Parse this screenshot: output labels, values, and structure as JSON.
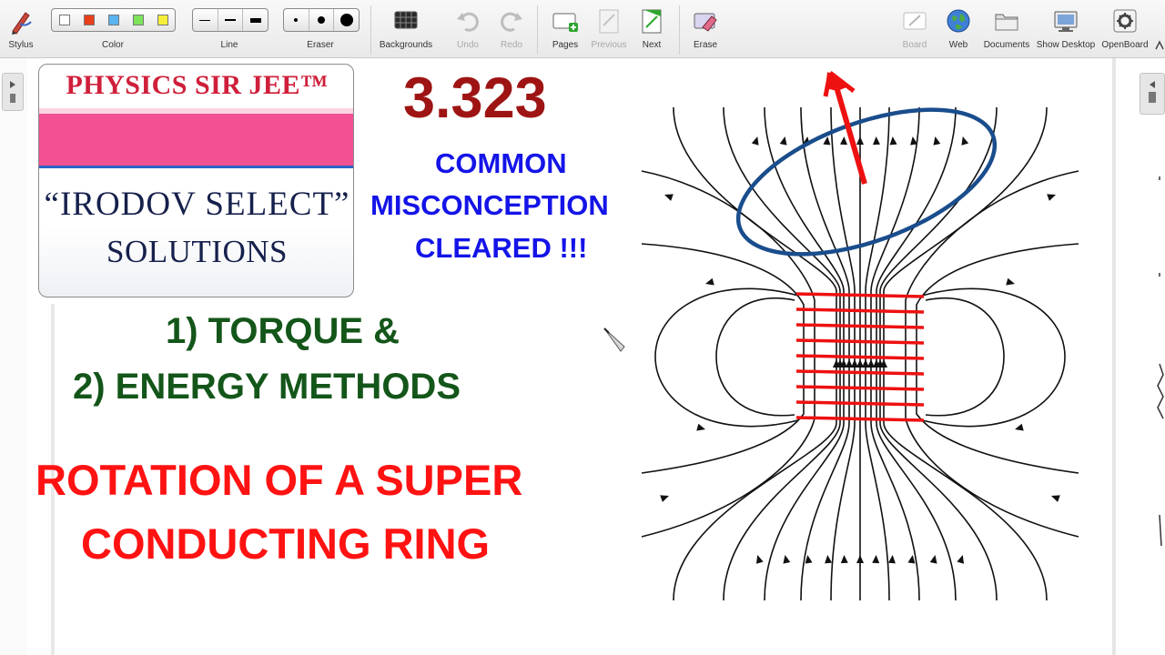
{
  "toolbar": {
    "stylus_label": "Stylus",
    "color_label": "Color",
    "line_label": "Line",
    "eraser_label": "Eraser",
    "backgrounds_label": "Backgrounds",
    "undo_label": "Undo",
    "redo_label": "Redo",
    "pages_label": "Pages",
    "previous_label": "Previous",
    "next_label": "Next",
    "erase_label": "Erase",
    "board_label": "Board",
    "web_label": "Web",
    "documents_label": "Documents",
    "show_desktop_label": "Show Desktop",
    "openboard_label": "OpenBoard",
    "colors": [
      "#ffffff",
      "#e8401c",
      "#5ab4f0",
      "#7ee35a",
      "#f7ee3a"
    ]
  },
  "card": {
    "brand": "PHYSICS SIR JEE™",
    "series": "“IRODOV SELECT”",
    "subtitle": "SOLUTIONS",
    "band_color": "#f34f93"
  },
  "headline": {
    "problem_number": "3.323",
    "misconception_1": "COMMON",
    "misconception_2": "MISCONCEPTION",
    "misconception_3": "CLEARED !!!",
    "method_1": "1) TORQUE &",
    "method_2": "2) ENERGY METHODS",
    "topic_1": "ROTATION OF A SUPER",
    "topic_2": "CONDUCTING RING"
  },
  "diagram": {
    "field_line_color": "#111111",
    "coil_color": "#ee1111",
    "ring_color": "#1a4d8c",
    "arrow_color": "#ee1111"
  }
}
